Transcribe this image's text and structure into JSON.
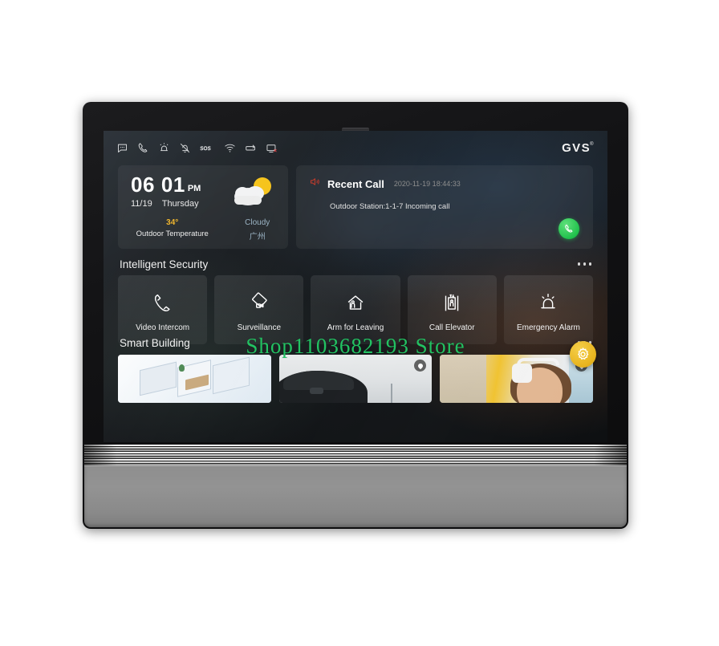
{
  "brand": {
    "name": "GVS",
    "trademark": "®"
  },
  "statusbar": {
    "icons": [
      {
        "name": "message-icon",
        "title": "Messages"
      },
      {
        "name": "phone-icon",
        "title": "Call"
      },
      {
        "name": "alarm-siren-icon",
        "title": "Alarm"
      },
      {
        "name": "bell-muted-icon",
        "title": "Mute"
      },
      {
        "name": "sos-icon",
        "title": "SOS"
      },
      {
        "name": "wifi-icon",
        "title": "Wi-Fi"
      },
      {
        "name": "do-not-disturb-icon",
        "title": "Do Not Disturb"
      },
      {
        "name": "monitor-disconnected-icon",
        "title": "Monitor Disconnected"
      }
    ]
  },
  "weather_card": {
    "hour": "06",
    "minute": "01",
    "ampm": "PM",
    "date": "11/19",
    "weekday": "Thursday",
    "temperature": "34°",
    "temperature_label": "Outdoor Temperature",
    "condition": "Cloudy",
    "city": "广州",
    "icon": "sun-behind-cloud-icon"
  },
  "recent_call": {
    "title": "Recent Call",
    "timestamp": "2020-11-19 18:44:33",
    "detail": "Outdoor Station:1-1-7 Incoming call",
    "speaker_icon": "speaker-icon",
    "callback_icon": "phone-callback-icon",
    "callback_color": "#1fc14a"
  },
  "sections": [
    {
      "id": "intelligent-security",
      "title": "Intelligent Security",
      "more_label": "More",
      "tiles": [
        {
          "label": "Video Intercom",
          "icon": "handset-icon"
        },
        {
          "label": "Surveillance",
          "icon": "camera-icon"
        },
        {
          "label": "Arm for Leaving",
          "icon": "home-shield-icon"
        },
        {
          "label": "Call Elevator",
          "icon": "elevator-icon"
        },
        {
          "label": "Emergency Alarm",
          "icon": "siren-icon"
        }
      ]
    },
    {
      "id": "smart-building",
      "title": "Smart Building",
      "more_label": "More",
      "thumbnails": [
        {
          "name": "floor-plan-thumbnail",
          "has_pin": false
        },
        {
          "name": "parking-camera-thumbnail",
          "has_pin": true
        },
        {
          "name": "person-headphones-thumbnail",
          "has_pin": true
        }
      ]
    }
  ],
  "fab": {
    "icon": "gear-icon",
    "label": "Settings",
    "color": "#e8b520"
  },
  "watermark": {
    "text": "Shop1103682193 Store",
    "color": "#22c262"
  }
}
